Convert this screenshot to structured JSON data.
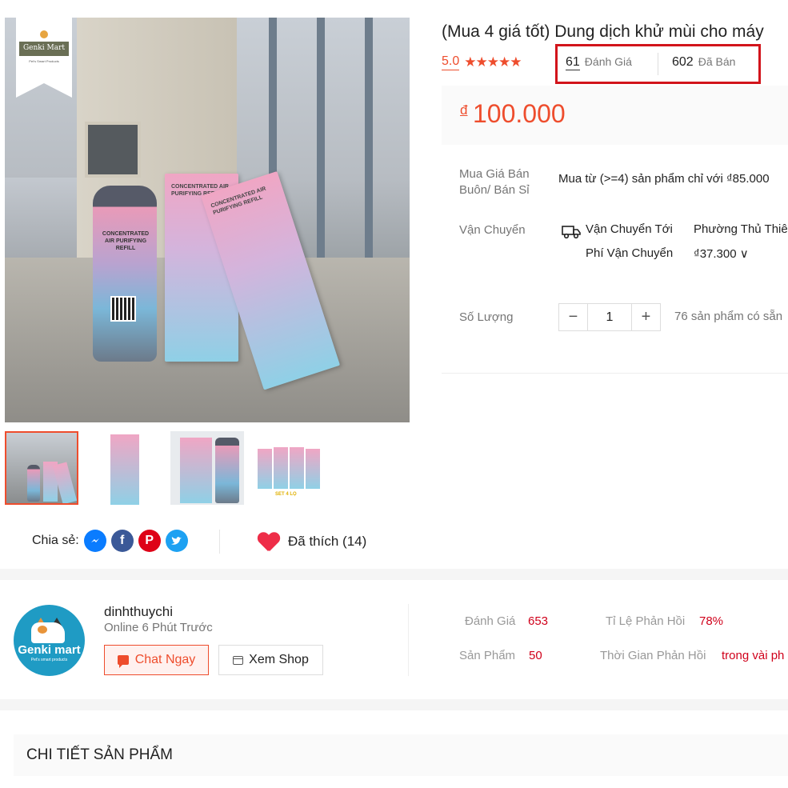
{
  "colors": {
    "accent": "#ee4d2d",
    "highlight_border": "#d2141b",
    "status_red": "#d0011b"
  },
  "gallery": {
    "badge": {
      "brand": "Genki Mart",
      "tagline": "Pet's Smart Products"
    },
    "product_text": {
      "bottle": "CONCENTRATED AIR PURIFYING REFILL",
      "box": "CONCENTRATED AIR PURIFYING REFILL"
    },
    "thumbnails": [
      {
        "name": "thumb-1",
        "active": true
      },
      {
        "name": "thumb-2",
        "active": false
      },
      {
        "name": "thumb-3",
        "active": false
      },
      {
        "name": "thumb-4",
        "active": false,
        "caption": "SET 4 LỌ"
      }
    ]
  },
  "share": {
    "label": "Chia sẻ:",
    "icons": [
      "messenger-icon",
      "facebook-icon",
      "pinterest-icon",
      "twitter-icon"
    ]
  },
  "like": {
    "label": "Đã thích (14)"
  },
  "product": {
    "title": "(Mua 4 giá tốt) Dung dịch khử mùi cho máy",
    "rating": "5.0",
    "stars": "★★★★★",
    "review_count": "61",
    "review_label": "Đánh Giá",
    "sold_count": "602",
    "sold_label": "Đã Bán",
    "currency": "đ",
    "price": "100.000"
  },
  "wholesale": {
    "label": "Mua Giá Bán Buôn/ Bán Sỉ",
    "text": "Mua từ (>=4) sản phẩm chỉ với ₫85.000"
  },
  "shipping": {
    "label": "Vận Chuyển",
    "to_label": "Vận Chuyển Tới",
    "to_value": "Phường Thủ Thiê",
    "fee_label": "Phí Vận Chuyển",
    "fee_value": "₫37.300 ∨"
  },
  "quantity": {
    "label": "Số Lượng",
    "minus": "−",
    "value": "1",
    "plus": "+",
    "stock": "76 sản phẩm có sẵn"
  },
  "shop": {
    "avatar_name": "Genki mart",
    "avatar_tagline": "Pet's smart products",
    "name": "dinhthuychi",
    "status": "Online 6 Phút Trước",
    "chat_label": "Chat Ngay",
    "view_label": "Xem Shop",
    "metrics": {
      "reviews_label": "Đánh Giá",
      "reviews_value": "653",
      "response_rate_label": "Tỉ Lệ Phản Hồi",
      "response_rate_value": "78%",
      "products_label": "Sản Phẩm",
      "products_value": "50",
      "response_time_label": "Thời Gian Phản Hồi",
      "response_time_value": "trong vài ph"
    }
  },
  "details": {
    "title": "CHI TIẾT SẢN PHẨM"
  }
}
